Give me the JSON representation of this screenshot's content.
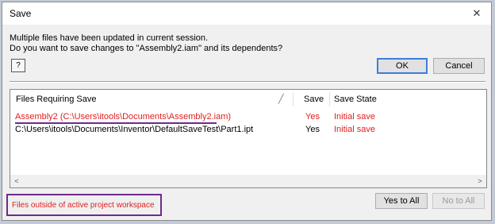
{
  "window": {
    "title": "Save",
    "close_glyph": "✕"
  },
  "message": {
    "line1": "Multiple files have been updated in current session.",
    "line2": "Do you want to save changes to \"Assembly2.iam\" and its dependents?"
  },
  "buttons": {
    "ok": "OK",
    "cancel": "Cancel",
    "yes_to_all": "Yes to All",
    "no_to_all": "No to All"
  },
  "help_icon": "?",
  "table": {
    "headers": {
      "files": "Files Requiring Save",
      "save": "Save",
      "state": "Save State"
    },
    "rows": [
      {
        "file": "Assembly2 (C:\\Users\\itools\\Documents\\Assembly2.iam)",
        "save": "Yes",
        "state": "Initial save",
        "color": "#e02020"
      },
      {
        "file": "C:\\Users\\itools\\Documents\\Inventor\\DefaultSaveTest\\Part1.ipt",
        "save": "Yes",
        "state": "Initial save",
        "color": "#000000"
      }
    ]
  },
  "footnote": "Files outside of active project workspace",
  "colors": {
    "highlight_red": "#e02020",
    "annotation_purple": "#6f2a8b",
    "ok_border": "#3c7fd8"
  }
}
